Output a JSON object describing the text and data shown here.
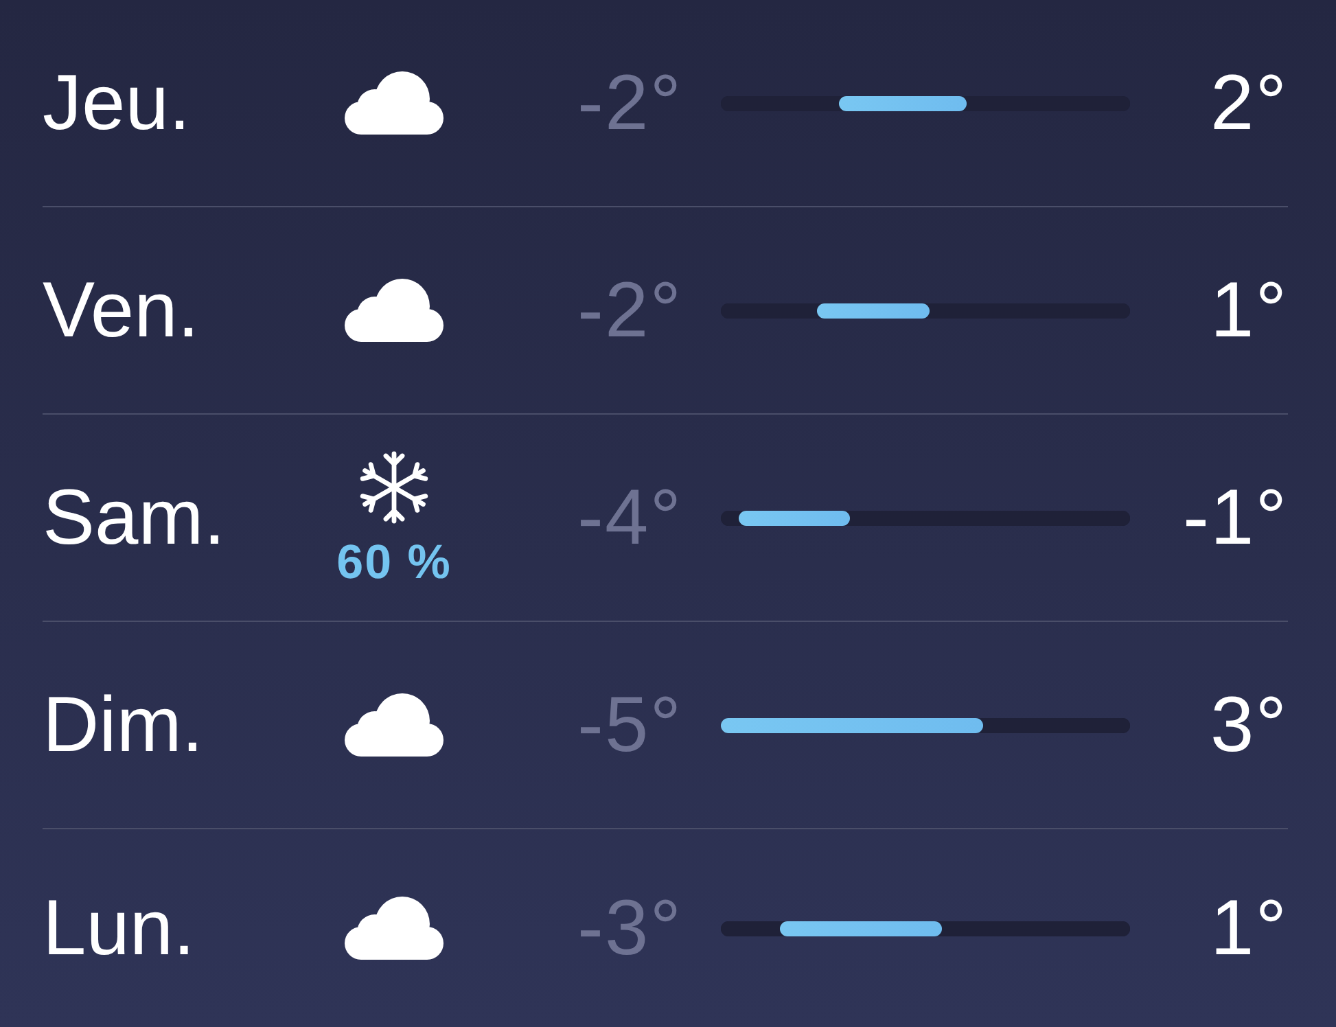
{
  "forecast": [
    {
      "day": "Jeu.",
      "kind": "cloud",
      "low": "-2°",
      "high": "2°",
      "range": {
        "before": {
          "level": 0.29
        },
        "after": {
          "level": 0.4
        }
      }
    },
    {
      "day": "Ven.",
      "kind": "cloud",
      "low": "-2°",
      "high": "1°",
      "range": {
        "before": {
          "level": 0.235
        },
        "after": {
          "level": 0.49
        }
      }
    },
    {
      "day": "Sam.",
      "kind": "snow",
      "precipitation": "60 %",
      "low": "-4°",
      "high": "-1°",
      "range": {
        "before": {
          "level": 0.045
        },
        "after": {
          "level": 0.685
        }
      }
    },
    {
      "day": "Dim.",
      "kind": "cloud",
      "low": "-5°",
      "high": "3°",
      "range": {
        "after": {
          "level": 0.36
        }
      }
    },
    {
      "day": "Lun.",
      "kind": "cloud",
      "low": "-3°",
      "high": "1°",
      "range": {
        "before": {
          "level": 0.145
        },
        "after": {
          "level": 0.46
        }
      }
    }
  ]
}
